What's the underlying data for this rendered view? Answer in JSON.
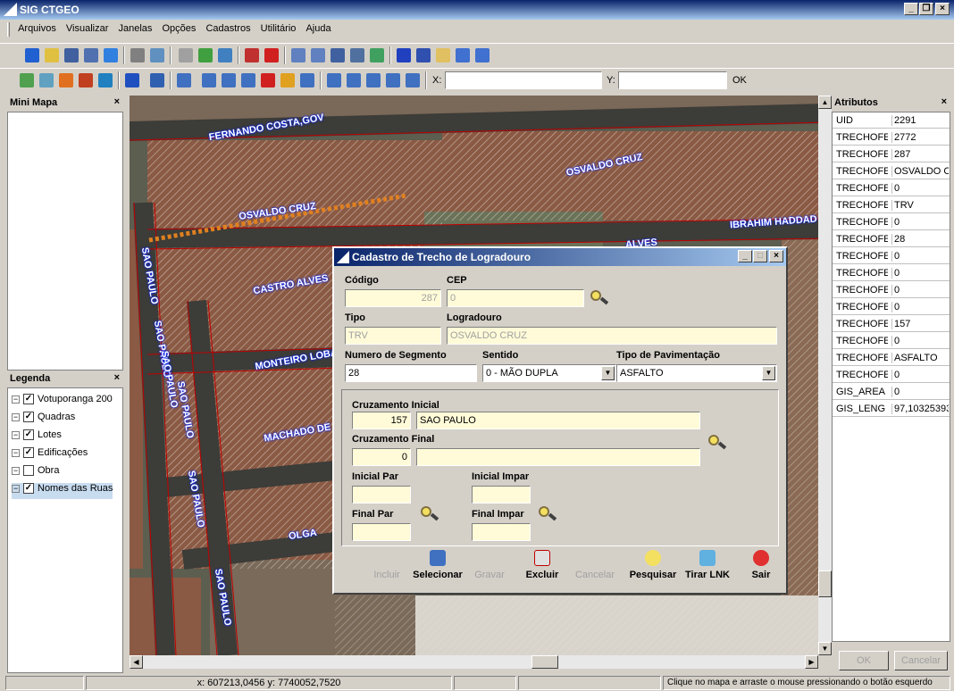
{
  "window": {
    "title": "SIG CTGEO"
  },
  "menu": [
    "Arquivos",
    "Visualizar",
    "Janelas",
    "Opções",
    "Cadastros",
    "Utilitário",
    "Ajuda"
  ],
  "toolbar": {
    "x_label": "X:",
    "y_label": "Y:",
    "ok_label": "OK",
    "x_value": "",
    "y_value": ""
  },
  "minimap": {
    "title": "Mini Mapa"
  },
  "legend": {
    "title": "Legenda",
    "items": [
      {
        "label": "Votuporanga 200",
        "checked": true
      },
      {
        "label": "Quadras",
        "checked": true
      },
      {
        "label": "Lotes",
        "checked": true
      },
      {
        "label": "Edificações",
        "checked": true
      },
      {
        "label": "Obra",
        "checked": false
      },
      {
        "label": "Nomes das Ruas",
        "checked": true
      }
    ]
  },
  "map": {
    "streets": [
      "FERNANDO COSTA,GOV",
      "OSVALDO CRUZ",
      "OSVALDO CRUZ",
      "IBRAHIM HADDAD",
      "CASTRO ALVES",
      "MONTEIRO LOBA",
      "MACHADO DE",
      "OLGA",
      "SAO PAULO",
      "SAO PAULO",
      "SAO PAULO",
      "SAO PAULO",
      "SAO PAULO",
      "SAO PAULO",
      "ALVES"
    ]
  },
  "attributes": {
    "title": "Atributos",
    "rows": [
      {
        "k": "UID",
        "v": "2291"
      },
      {
        "k": "TRECHOFE",
        "v": "2772"
      },
      {
        "k": "TRECHOFE",
        "v": "287"
      },
      {
        "k": "TRECHOFE",
        "v": "OSVALDO C"
      },
      {
        "k": "TRECHOFE",
        "v": "0"
      },
      {
        "k": "TRECHOFE",
        "v": "TRV"
      },
      {
        "k": "TRECHOFE",
        "v": "0"
      },
      {
        "k": "TRECHOFE",
        "v": "28"
      },
      {
        "k": "TRECHOFE",
        "v": "0"
      },
      {
        "k": "TRECHOFE",
        "v": "0"
      },
      {
        "k": "TRECHOFE",
        "v": "0"
      },
      {
        "k": "TRECHOFE",
        "v": "0"
      },
      {
        "k": "TRECHOFE",
        "v": "157"
      },
      {
        "k": "TRECHOFE",
        "v": "0"
      },
      {
        "k": "TRECHOFE",
        "v": "ASFALTO"
      },
      {
        "k": "TRECHOFE",
        "v": "0"
      },
      {
        "k": "GIS_AREA",
        "v": "0"
      },
      {
        "k": "GIS_LENG",
        "v": "97,10325393"
      }
    ],
    "ok_label": "OK",
    "cancel_label": "Cancelar"
  },
  "status": {
    "coords": "x: 607213,0456 y: 7740052,7520",
    "hint": "Clique no mapa e arraste o mouse pressionando o botão esquerdo"
  },
  "dialog": {
    "title": "Cadastro de Trecho de Logradouro",
    "codigo_label": "Código",
    "codigo": "287",
    "cep_label": "CEP",
    "cep": "0",
    "tipo_label": "Tipo",
    "tipo": "TRV",
    "logradouro_label": "Logradouro",
    "logradouro": "OSVALDO CRUZ",
    "numseg_label": "Numero de Segmento",
    "numseg": "28",
    "sentido_label": "Sentido",
    "sentido": "0 - MÃO DUPLA",
    "pav_label": "Tipo de Pavimentação",
    "pav": "ASFALTO",
    "cruz_ini_label": "Cruzamento Inicial",
    "cruz_ini_num": "157",
    "cruz_ini_nome": "SAO PAULO",
    "cruz_fin_label": "Cruzamento Final",
    "cruz_fin_num": "0",
    "cruz_fin_nome": "",
    "ini_par_label": "Inicial Par",
    "ini_impar_label": "Inicial Impar",
    "fin_par_label": "Final Par",
    "fin_impar_label": "Final Impar",
    "buttons": {
      "incluir": "Incluir",
      "selecionar": "Selecionar",
      "gravar": "Gravar",
      "excluir": "Excluir",
      "cancelar": "Cancelar",
      "pesquisar": "Pesquisar",
      "tirar_lnk": "Tirar LNK",
      "sair": "Sair"
    }
  },
  "colors": {
    "title_start": "#0a246a",
    "title_end": "#a6caf0",
    "field_bg": "#fffbd8",
    "street_glow": "#0020ff",
    "lot_red": "#c00000"
  }
}
